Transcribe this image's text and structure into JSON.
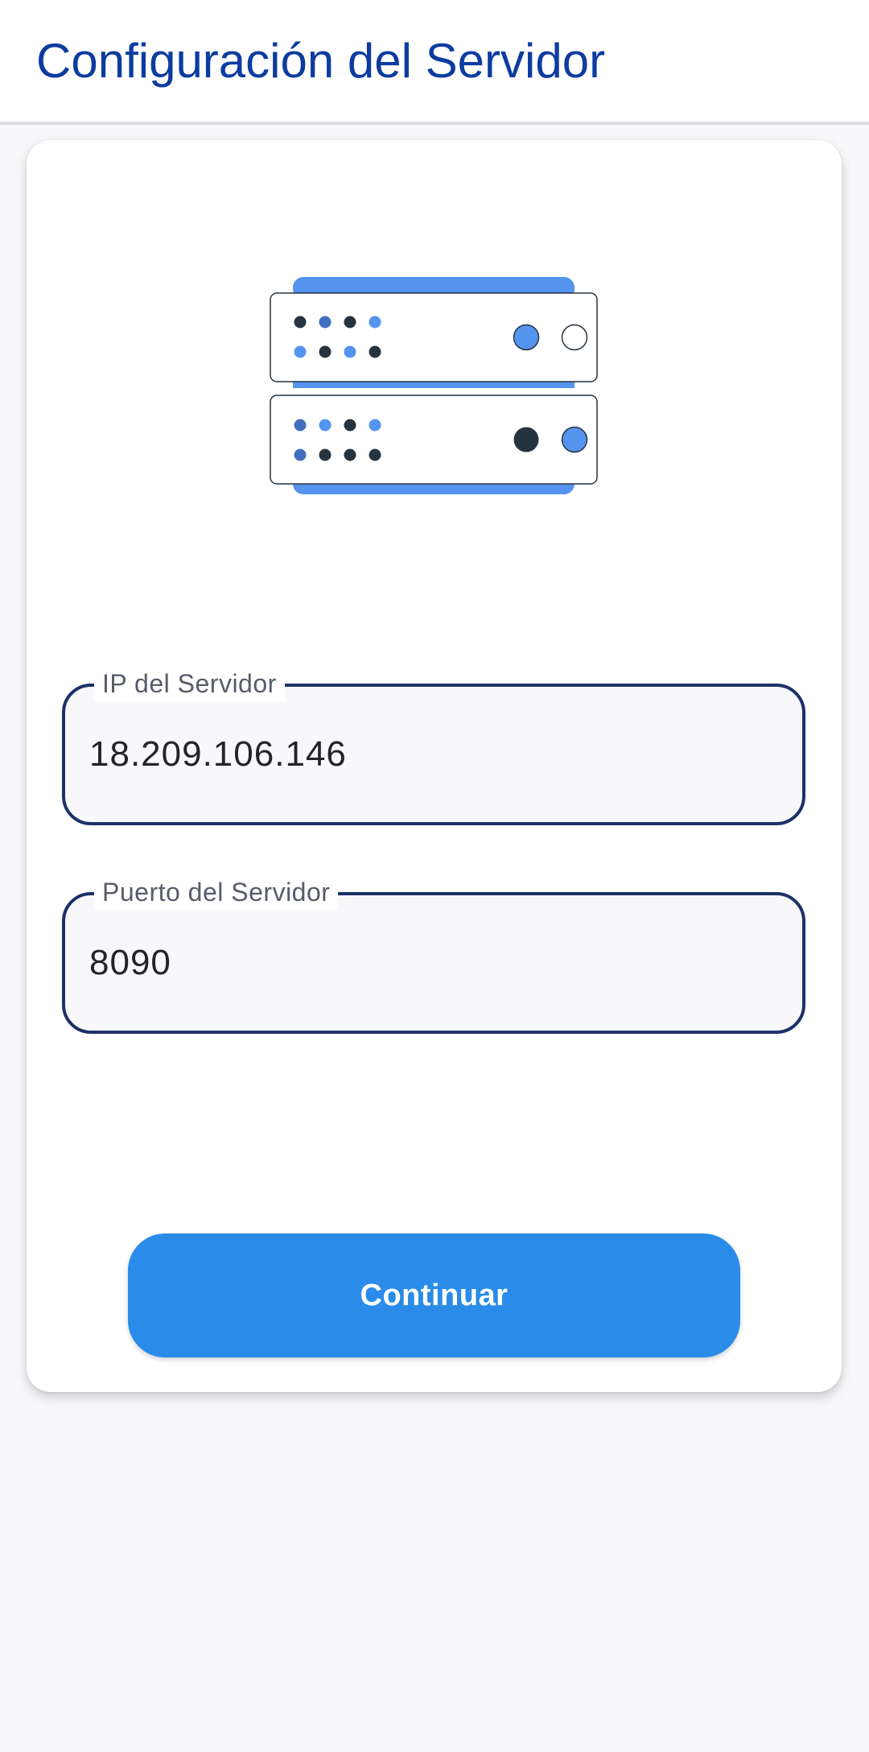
{
  "app_bar": {
    "title": "Configuración del Servidor"
  },
  "form": {
    "ip_field": {
      "label": "IP del Servidor",
      "value": "18.209.106.146"
    },
    "port_field": {
      "label": "Puerto del Servidor",
      "value": "8090"
    },
    "continue_button": {
      "label": "Continuar"
    }
  },
  "illustration": {
    "icon": "server-rack-icon",
    "colors": {
      "accent": "#5494ef",
      "dark": "#263440",
      "mid_blue": "#3f6fbf"
    }
  },
  "colors": {
    "title": "#0d3ca0",
    "field_border": "#1c3168",
    "button": "#2a8ce8",
    "background": "#f8f8fb"
  }
}
